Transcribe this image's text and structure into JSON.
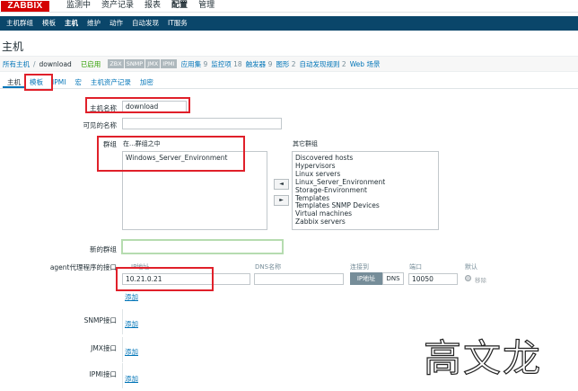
{
  "app": {
    "logo": "ZABBIX",
    "main_menu": [
      "监测中",
      "资产记录",
      "报表",
      "配置",
      "管理"
    ],
    "active_main": "配置",
    "sub_menu": [
      "主机群组",
      "模板",
      "主机",
      "维护",
      "动作",
      "自动发现",
      "IT服务"
    ],
    "active_sub": "主机"
  },
  "page": {
    "title": "主机"
  },
  "breadcrumb": {
    "all_hosts": "所有主机",
    "sep": "/",
    "host": "download",
    "status": "已启用",
    "availability": [
      "ZBX",
      "SNMP",
      "JMX",
      "IPMI"
    ],
    "links": [
      {
        "label": "应用集",
        "count": "9"
      },
      {
        "label": "监控项",
        "count": "18"
      },
      {
        "label": "触发器",
        "count": "9"
      },
      {
        "label": "图形",
        "count": "2"
      },
      {
        "label": "自动发现规则",
        "count": "2"
      },
      {
        "label": "Web 场景",
        "count": ""
      }
    ]
  },
  "tabs": [
    "主机",
    "模板",
    "IPMI",
    "宏",
    "主机资产记录",
    "加密"
  ],
  "active_tab": "主机",
  "form": {
    "host_name_label": "主机名称",
    "host_name_value": "download",
    "visible_name_label": "可见的名称",
    "visible_name_value": "",
    "groups_label": "群组",
    "in_groups_label": "在...群组之中",
    "in_groups": [
      "Windows_Server_Environment"
    ],
    "other_groups_label": "其它群组",
    "other_groups": [
      "Discovered hosts",
      "Hypervisors",
      "Linux servers",
      "Linux_Server_Environment",
      "Storage-Environment",
      "Templates",
      "Templates SNMP Devices",
      "Virtual machines",
      "Zabbix servers"
    ],
    "move_left": "◄",
    "move_right": "►",
    "new_group_label": "新的群组",
    "new_group_value": "",
    "agent_interfaces_label": "agent代理程序的接口",
    "col_ip": "IP地址",
    "col_dns": "DNS名称",
    "col_connect": "连接到",
    "col_port": "端口",
    "col_default": "默认",
    "ip_value": "10.21.0.21",
    "dns_value": "",
    "connect_ip": "IP地址",
    "connect_dns": "DNS",
    "port_value": "10050",
    "default_radio": "移除",
    "add_link": "添加",
    "snmp_label": "SNMP接口",
    "jmx_label": "JMX接口",
    "ipmi_label": "IPMI接口"
  },
  "watermark": "高文龙",
  "colors": {
    "logo_bg": "#d40000",
    "subbar_bg": "#0a466a",
    "link": "#0275b8",
    "annotation_red": "#e0202a",
    "enabled_green": "#2f9f00"
  }
}
